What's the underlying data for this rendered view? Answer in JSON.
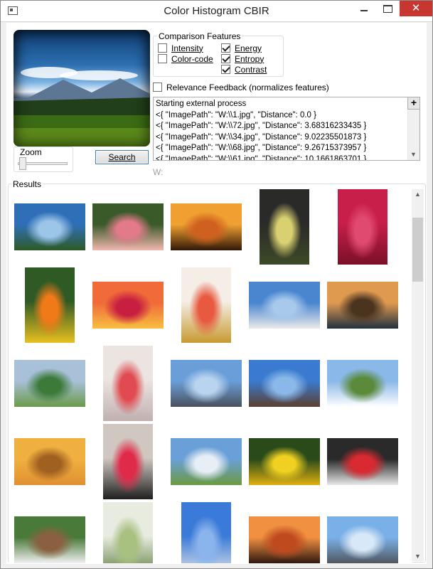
{
  "window": {
    "title": "Color Histogram CBIR",
    "minimize_icon": "minimize-icon",
    "maximize_icon": "maximize-icon",
    "close_glyph": "✕"
  },
  "zoom": {
    "label": "Zoom",
    "value": 0
  },
  "search": {
    "label": "Search"
  },
  "features": {
    "label": "Comparison Features",
    "items": [
      {
        "label": "Intensity",
        "checked": false
      },
      {
        "label": "Color-code",
        "checked": false
      },
      {
        "label": "Energy",
        "checked": true
      },
      {
        "label": "Entropy",
        "checked": true
      },
      {
        "label": "Contrast",
        "checked": true
      }
    ]
  },
  "relevance": {
    "label": "Relevance Feedback (normalizes features)",
    "checked": false
  },
  "log": {
    "plus_label": "+",
    "lines": [
      "Starting external process",
      "<{ \"ImagePath\": \"W:\\\\1.jpg\", \"Distance\": 0.0 }",
      "<{ \"ImagePath\": \"W:\\\\72.jpg\", \"Distance\": 3.68316233435 }",
      "<{ \"ImagePath\": \"W:\\\\34.jpg\", \"Distance\": 9.02235501873 }",
      "<{ \"ImagePath\": \"W:\\\\68.jpg\", \"Distance\": 9.26715373957 }",
      "<{ \"ImagePath\": \"W:\\\\61.jpg\", \"Distance\": 10.1661863701 }"
    ]
  },
  "path_label": "W:",
  "results": {
    "label": "Results",
    "thumbnails": [
      {
        "name": "landscape-mountains",
        "colors": [
          "#2f6fb8",
          "#9cc5e8",
          "#2e5a24"
        ]
      },
      {
        "name": "pink-flower",
        "colors": [
          "#3a5a2a",
          "#e37a8a",
          "#f2b8b0"
        ]
      },
      {
        "name": "desert-sunset",
        "colors": [
          "#f0a030",
          "#d06020",
          "#301808"
        ]
      },
      {
        "name": "yellow-orchid",
        "colors": [
          "#2a2a28",
          "#d9d070",
          "#3c4a28"
        ]
      },
      {
        "name": "red-hibiscus",
        "colors": [
          "#c81e4a",
          "#e04a70",
          "#7a1028"
        ]
      },
      {
        "name": "orange-daisy",
        "colors": [
          "#305a24",
          "#f07a18",
          "#e8c020"
        ]
      },
      {
        "name": "ocean-sunset",
        "colors": [
          "#f06a3a",
          "#c81e40",
          "#f7c040"
        ]
      },
      {
        "name": "cocktail-glass",
        "colors": [
          "#f4eee6",
          "#e85a40",
          "#c89a30"
        ]
      },
      {
        "name": "jet-plane-sky",
        "colors": [
          "#4a86d0",
          "#a8c8ec",
          "#eaeaea"
        ]
      },
      {
        "name": "rocky-coast",
        "colors": [
          "#e09a50",
          "#4a3420",
          "#203040"
        ]
      },
      {
        "name": "green-hills",
        "colors": [
          "#a8c0d8",
          "#3c7a3a",
          "#6a9a4a"
        ]
      },
      {
        "name": "martini-glass",
        "colors": [
          "#ece4e0",
          "#e04a50",
          "#c0b0b0"
        ]
      },
      {
        "name": "fighter-jet",
        "colors": [
          "#6a9ed8",
          "#b8d4ef",
          "#4a5060"
        ]
      },
      {
        "name": "propeller-plane",
        "colors": [
          "#3a7ad0",
          "#8ab8e8",
          "#5a4030"
        ]
      },
      {
        "name": "cattle-field",
        "colors": [
          "#8ab8e8",
          "#5a8a3a",
          "#ffffff"
        ]
      },
      {
        "name": "golden-clouds",
        "colors": [
          "#f0b040",
          "#a06020",
          "#e09030"
        ]
      },
      {
        "name": "red-cocktail",
        "colors": [
          "#d0c8c0",
          "#e02a4a",
          "#202020"
        ]
      },
      {
        "name": "horse-rider-field",
        "colors": [
          "#6aa0d8",
          "#e8eef6",
          "#6a9a40"
        ]
      },
      {
        "name": "yellow-lily",
        "colors": [
          "#2a4a1a",
          "#f0d020",
          "#e0b010"
        ]
      },
      {
        "name": "strawberry-spoon",
        "colors": [
          "#2a2a2a",
          "#d82a30",
          "#e8e8e8"
        ]
      },
      {
        "name": "horses-meadow",
        "colors": [
          "#4a7a3a",
          "#8a6040",
          "#f0f0f0"
        ]
      },
      {
        "name": "white-lily",
        "colors": [
          "#e8ece0",
          "#a8c080",
          "#5a7a3a"
        ]
      },
      {
        "name": "jet-formation",
        "colors": [
          "#3a7ad8",
          "#8ab4ec",
          "#e8e8e8"
        ]
      },
      {
        "name": "birds-sunset",
        "colors": [
          "#f09040",
          "#c04a20",
          "#301810"
        ]
      },
      {
        "name": "jet-over-clouds",
        "colors": [
          "#7ab0e8",
          "#d8e8f8",
          "#505860"
        ]
      }
    ]
  }
}
